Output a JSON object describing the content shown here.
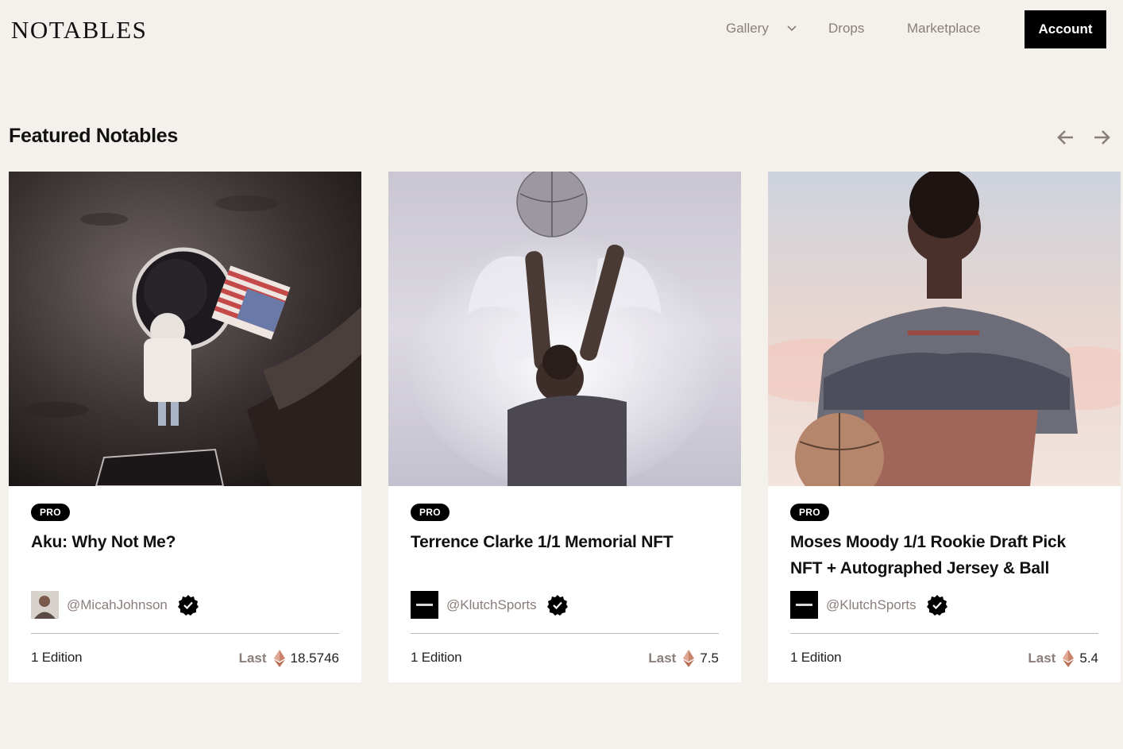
{
  "header": {
    "logo": "NOTABLES",
    "nav": {
      "gallery": "Gallery",
      "drops": "Drops",
      "marketplace": "Marketplace"
    },
    "account": "Account"
  },
  "section": {
    "title": "Featured Notables"
  },
  "colors": {
    "accent": "#000000",
    "muted_text": "#8a7e7b",
    "background": "#f4f1ec",
    "eth": "#c9836b"
  },
  "cards": [
    {
      "badge": "PRO",
      "title": "Aku: Why Not Me?",
      "creator": "@MicahJohnson",
      "edition": "1 Edition",
      "last_label": "Last",
      "price": "18.5746"
    },
    {
      "badge": "PRO",
      "title": "Terrence Clarke 1/1 Memorial NFT",
      "creator": "@KlutchSports",
      "edition": "1 Edition",
      "last_label": "Last",
      "price": "7.5"
    },
    {
      "badge": "PRO",
      "title": "Moses Moody 1/1 Rookie Draft Pick NFT + Autographed Jersey & Ball",
      "creator": "@KlutchSports",
      "edition": "1 Edition",
      "last_label": "Last",
      "price": "5.4"
    }
  ],
  "icons": [
    "chevron-down-icon",
    "arrow-left-icon",
    "arrow-right-icon",
    "verified-icon",
    "ethereum-icon"
  ]
}
